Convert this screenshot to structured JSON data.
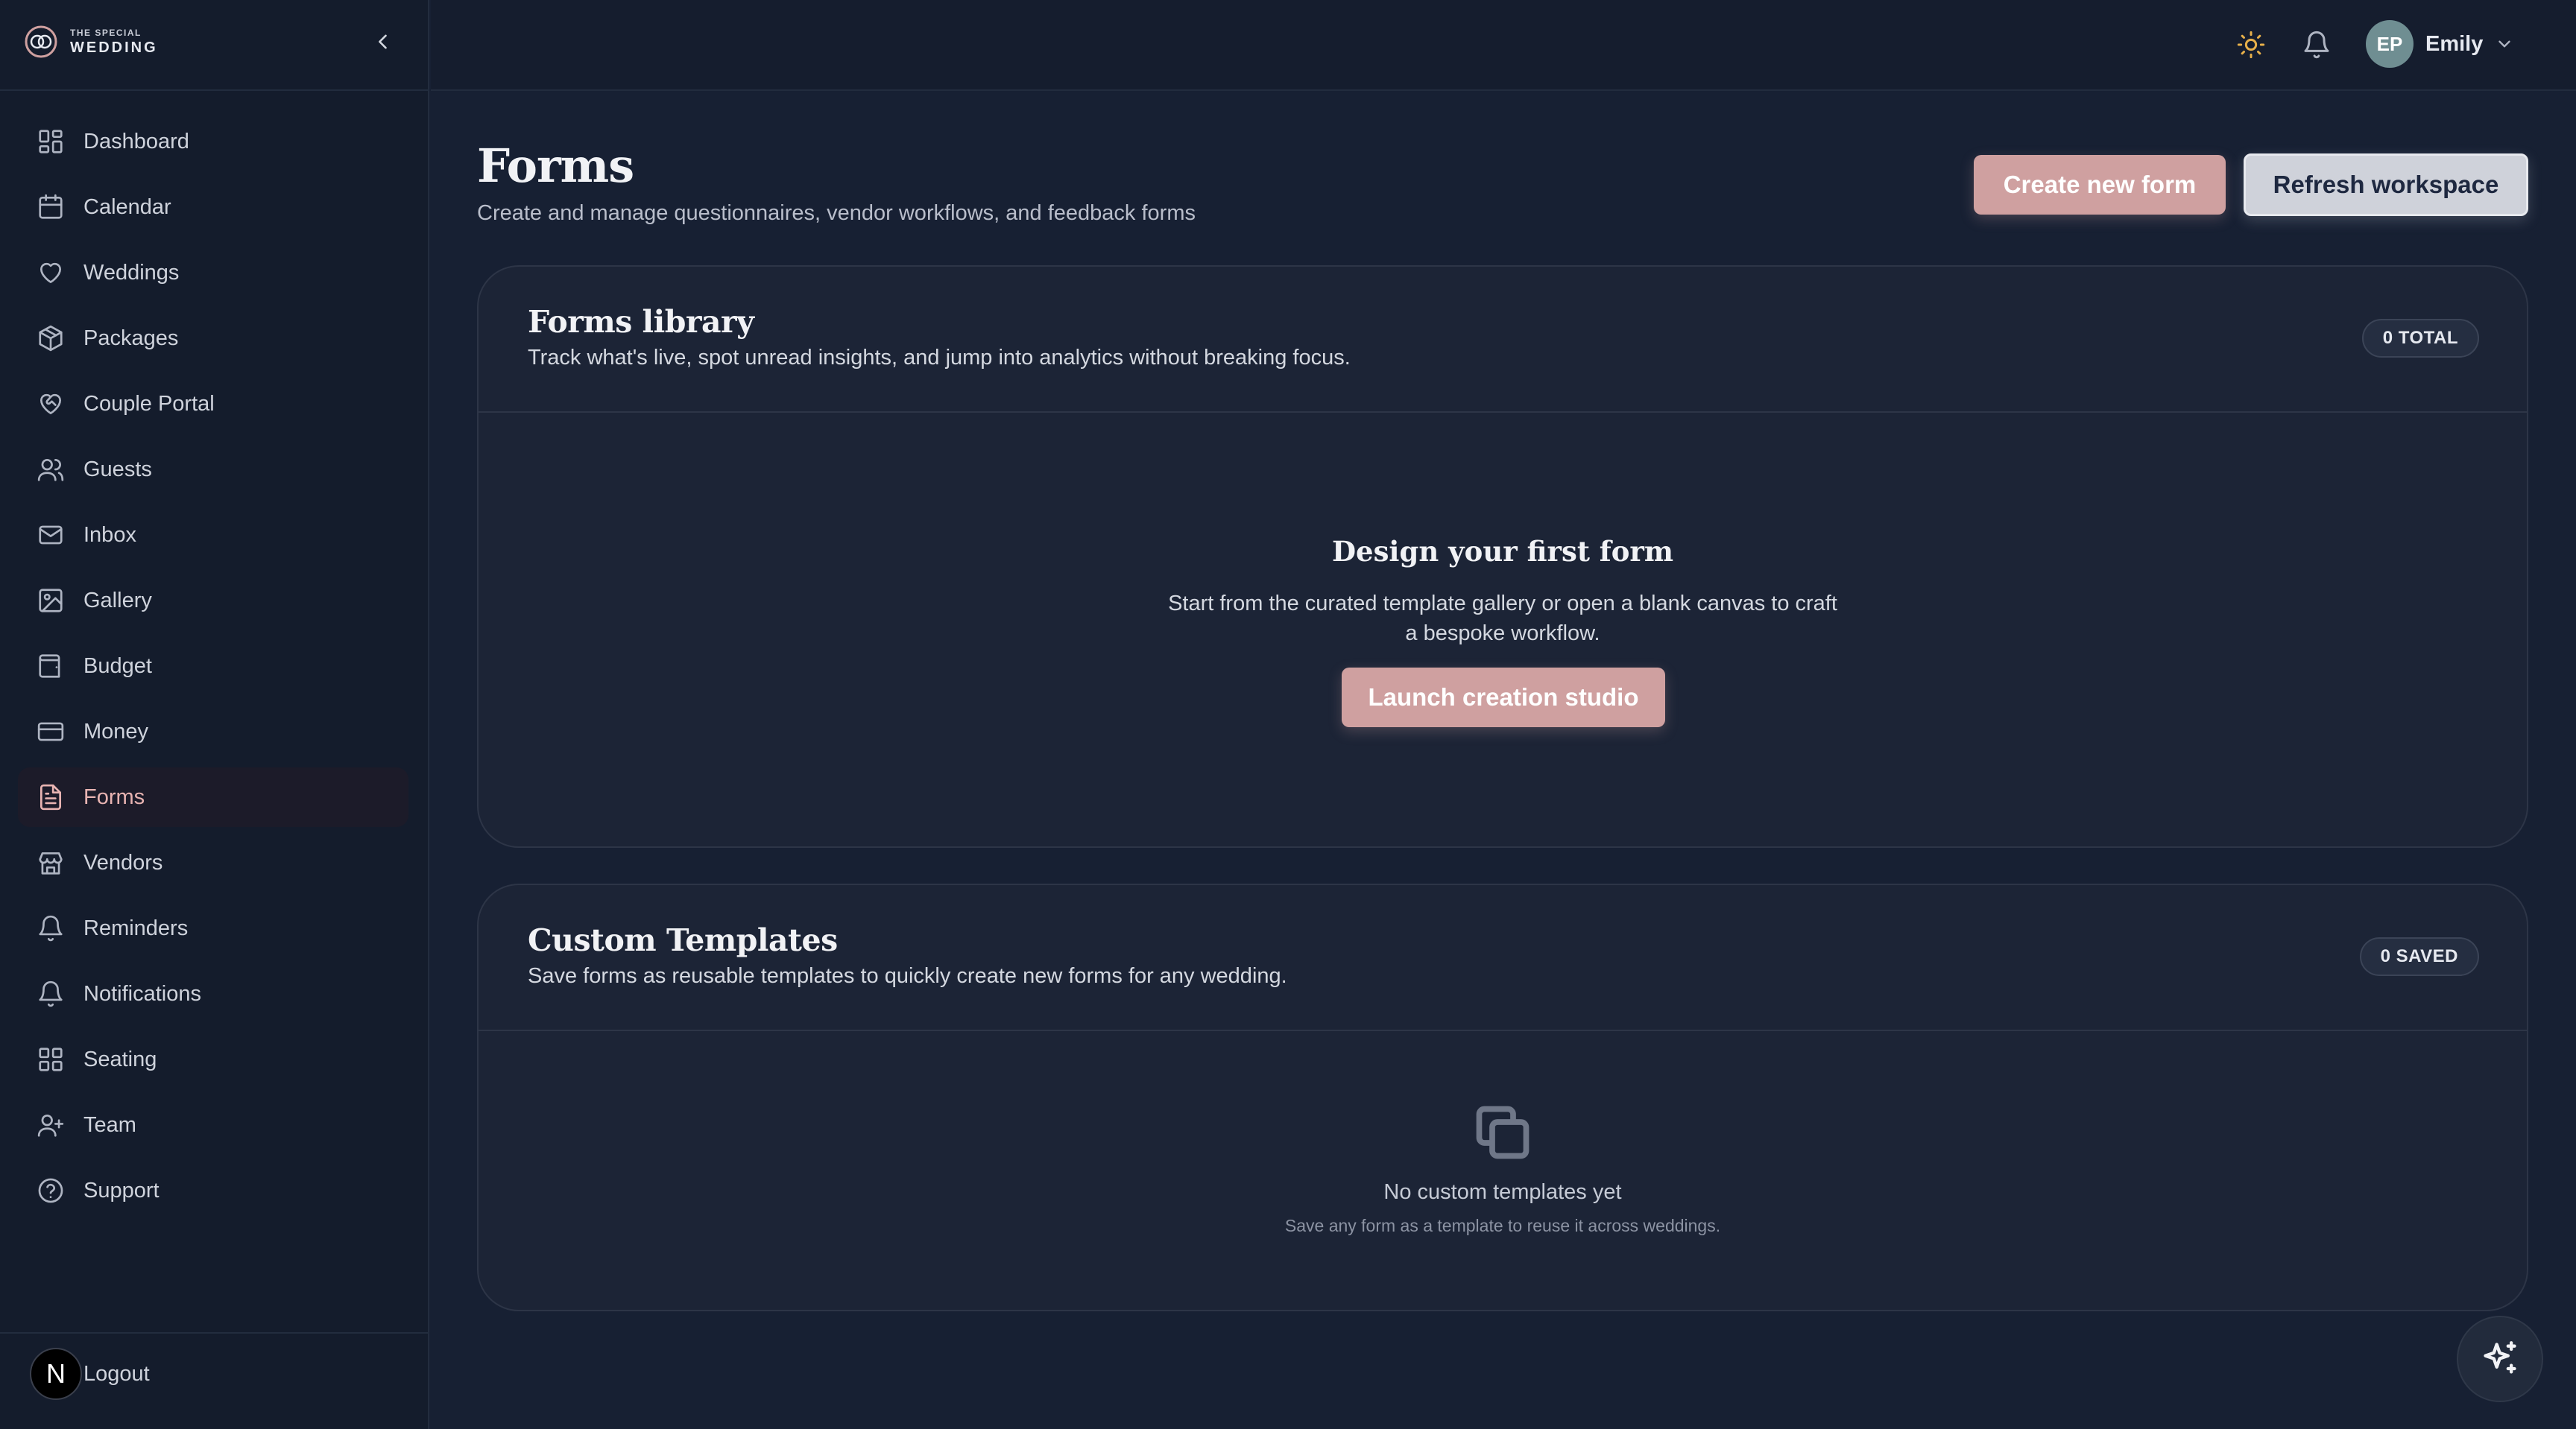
{
  "brand": {
    "small": "THE SPECIAL",
    "big": "WEDDING"
  },
  "sidebar": {
    "items": [
      {
        "label": "Dashboard",
        "icon": "dashboard-icon"
      },
      {
        "label": "Calendar",
        "icon": "calendar-icon"
      },
      {
        "label": "Weddings",
        "icon": "heart-icon"
      },
      {
        "label": "Packages",
        "icon": "package-icon"
      },
      {
        "label": "Couple Portal",
        "icon": "heart-handshake-icon"
      },
      {
        "label": "Guests",
        "icon": "users-icon"
      },
      {
        "label": "Inbox",
        "icon": "mail-icon"
      },
      {
        "label": "Gallery",
        "icon": "image-icon"
      },
      {
        "label": "Budget",
        "icon": "wallet-icon"
      },
      {
        "label": "Money",
        "icon": "credit-card-icon"
      },
      {
        "label": "Forms",
        "icon": "file-text-icon",
        "active": true
      },
      {
        "label": "Vendors",
        "icon": "store-icon"
      },
      {
        "label": "Reminders",
        "icon": "bell-icon"
      },
      {
        "label": "Notifications",
        "icon": "bell-icon"
      },
      {
        "label": "Seating",
        "icon": "grid-icon"
      },
      {
        "label": "Team",
        "icon": "user-plus-icon"
      },
      {
        "label": "Support",
        "icon": "help-circle-icon"
      }
    ],
    "logout": {
      "badge": "N",
      "label": "Logout"
    }
  },
  "topbar": {
    "user": {
      "initials": "EP",
      "name": "Emily"
    }
  },
  "page": {
    "title": "Forms",
    "subtitle": "Create and manage questionnaires, vendor workflows, and feedback forms",
    "create_label": "Create new form",
    "refresh_label": "Refresh workspace"
  },
  "library": {
    "title": "Forms library",
    "description": "Track what's live, spot unread insights, and jump into analytics without breaking focus.",
    "count_badge": "0 TOTAL",
    "empty_title": "Design your first form",
    "empty_text": "Start from the curated template gallery or open a blank canvas to craft a bespoke workflow.",
    "launch_label": "Launch creation studio"
  },
  "templates": {
    "title": "Custom Templates",
    "description": "Save forms as reusable templates to quickly create new forms for any wedding.",
    "count_badge": "0 SAVED",
    "empty_title": "No custom templates yet",
    "empty_text": "Save any form as a template to reuse it across weddings."
  },
  "colors": {
    "background": "#172033",
    "sidebar": "#141c2c",
    "accent": "#cfa0a0",
    "active_text": "#e8b4b2",
    "theme_icon": "#e7b04a"
  }
}
